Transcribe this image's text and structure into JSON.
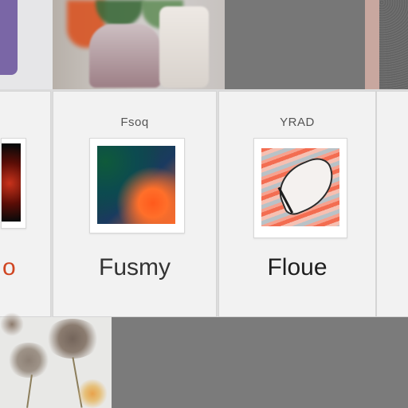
{
  "cards": [
    {
      "id": "left-partial",
      "title": "",
      "label": "o"
    },
    {
      "id": "middle",
      "title": "Fsoq",
      "label": "Fusmy"
    },
    {
      "id": "right",
      "title": "YRAD",
      "label": "Floue"
    }
  ],
  "colors": {
    "purple_accent": "#7a66a6",
    "tile_gray": "#777777",
    "card_bg": "#f2f2f2",
    "left_label_orange": "#d04622"
  },
  "icons": [
    "plant-photo",
    "gravel-photo",
    "dandelion-photo",
    "abstract-gradient-thumb",
    "feather-art-thumb"
  ]
}
